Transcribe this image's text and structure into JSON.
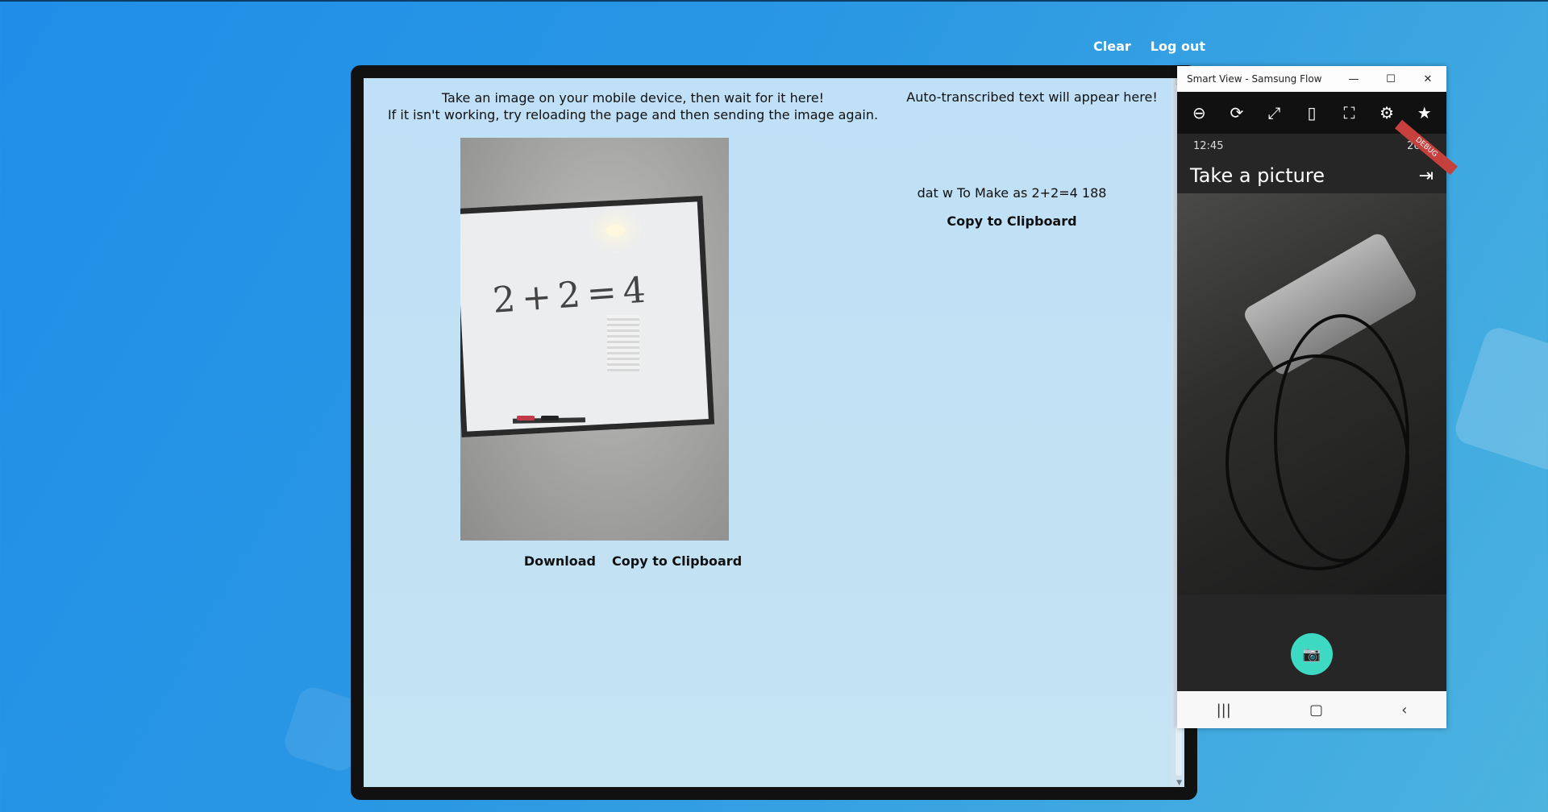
{
  "header": {
    "clear_label": "Clear",
    "logout_label": "Log out"
  },
  "left_panel": {
    "instruction_line1": "Take an image on your mobile device, then wait for it here!",
    "instruction_line2": "If it isn't working, try reloading the page and then sending the image again.",
    "photo_math_text": "2+2=4",
    "download_label": "Download",
    "copy_label": "Copy to Clipboard"
  },
  "right_panel": {
    "heading": "Auto-transcribed text will appear here!",
    "transcribed_text": "dat w To Make as 2+2=4 188",
    "copy_label": "Copy to Clipboard"
  },
  "flow_window": {
    "title": "Smart View - Samsung Flow",
    "controls": {
      "minimize": "—",
      "maximize": "☐",
      "close": "✕"
    },
    "toolbar_icons": [
      "minus-circle-icon",
      "rotate-icon",
      "expand-icon",
      "phone-icon",
      "screenshot-icon",
      "gear-icon",
      "star-icon"
    ],
    "status_time": "12:45",
    "status_right": "26%",
    "ribbon_text": "DEBUG",
    "app_title": "Take a picture"
  },
  "colors": {
    "background_start": "#1f8ee8",
    "background_end": "#4cb3df",
    "shutter": "#3dd9c2"
  }
}
